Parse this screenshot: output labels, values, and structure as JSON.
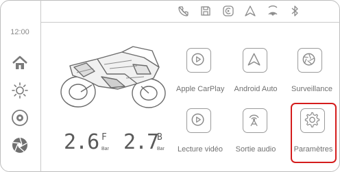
{
  "status_bar": {
    "icons": [
      "phone-off-icon",
      "save-icon",
      "carplay-icon",
      "android-auto-icon",
      "hotspot-icon",
      "bluetooth-icon"
    ]
  },
  "sidebar": {
    "time": "12:00",
    "items": [
      "home-icon",
      "brightness-icon",
      "camera-icon",
      "aperture-icon"
    ]
  },
  "tire_pressure": {
    "front_value": "2.6",
    "front_label": "F",
    "rear_value": "2.7",
    "rear_label": "B",
    "unit": "Bar"
  },
  "apps": [
    {
      "label": "Apple CarPlay",
      "icon": "carplay-icon"
    },
    {
      "label": "Android Auto",
      "icon": "android-auto-icon"
    },
    {
      "label": "Surveillance",
      "icon": "aperture-icon"
    },
    {
      "label": "Lecture vidéo",
      "icon": "play-icon"
    },
    {
      "label": "Sortie audio",
      "icon": "antenna-icon"
    },
    {
      "label": "Paramètres",
      "icon": "gear-icon"
    }
  ],
  "colors": {
    "highlight": "#d41c1c",
    "icon": "#9a9a9a"
  }
}
